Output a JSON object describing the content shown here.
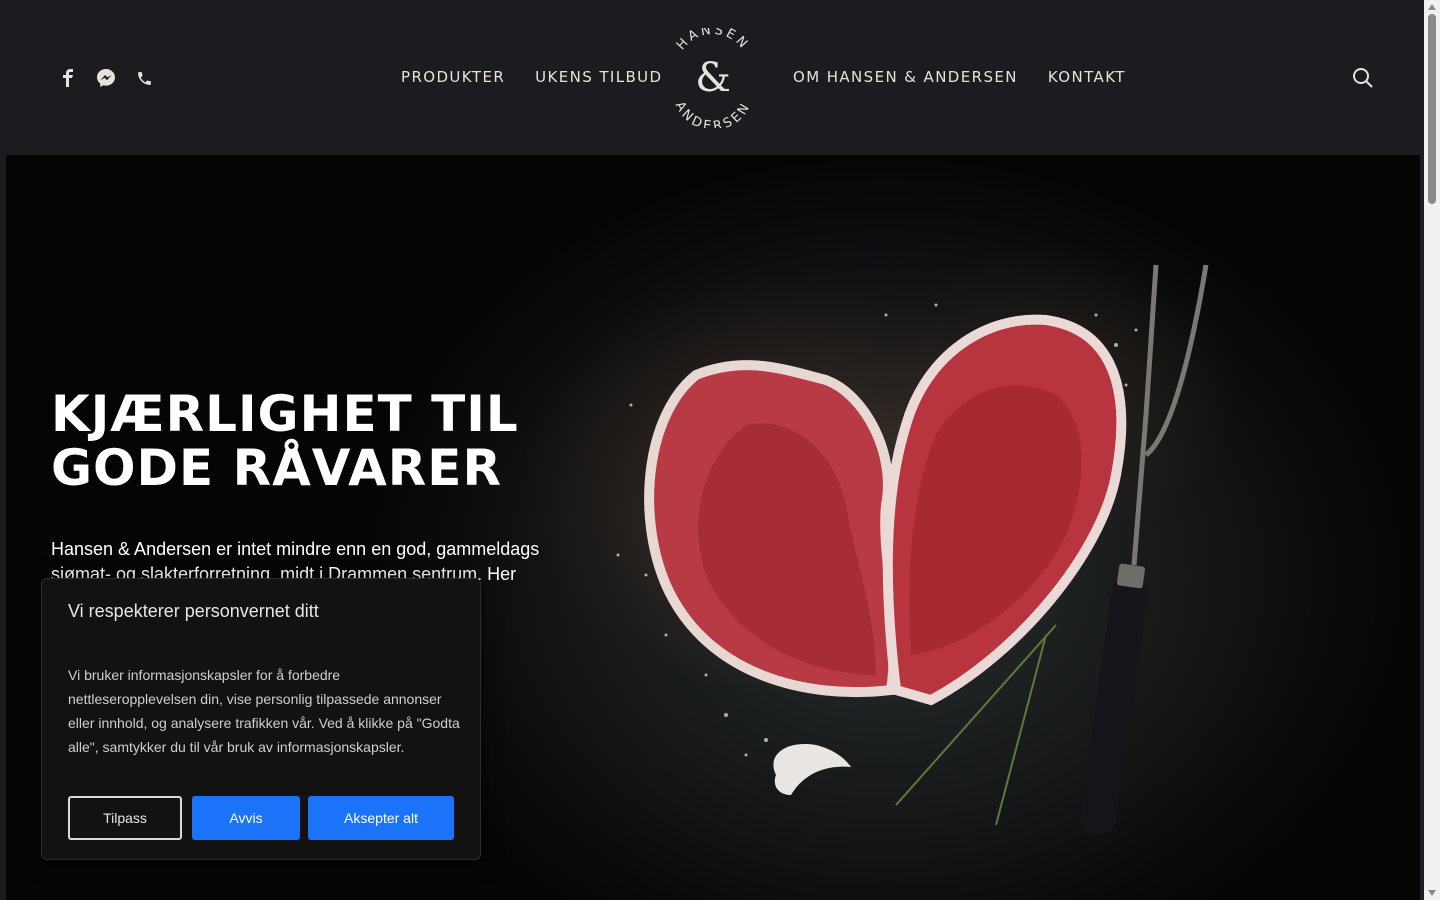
{
  "header": {
    "social_icons": [
      "facebook-icon",
      "messenger-icon",
      "phone-icon"
    ],
    "nav_left": [
      "PRODUKTER",
      "UKENS TILBUD"
    ],
    "nav_right": [
      "OM HANSEN & ANDERSEN",
      "KONTAKT"
    ],
    "logo": {
      "top_text": "HANSEN",
      "symbol": "&",
      "bottom_text": "ANDERSEN"
    },
    "search_icon": "search-icon"
  },
  "hero": {
    "title_line1": "KJÆRLIGHET TIL",
    "title_line2": "GODE RÅVARER",
    "text": "Hansen & Andersen er intet mindre enn en god, gammeldags sjømat- og slakterforretning, midt i Drammen sentrum. Her finner du Drammens beste fersk- og kjøttvarer"
  },
  "cookie": {
    "title": "Vi respekterer personvernet ditt",
    "body": "Vi bruker informasjonskapsler for å forbedre nettleseropplevelsen din, vise personlig tilpassede annonser eller innhold, og analysere trafikken vår. Ved å klikke på \"Godta alle\", samtykker du til vår bruk av informasjonskapsler.",
    "customize_label": "Tilpass",
    "reject_label": "Avvis",
    "accept_label": "Aksepter alt"
  },
  "colors": {
    "header_bg": "#1c1b20",
    "nav_text": "#e7e2da",
    "button_blue": "#1a73f8"
  }
}
